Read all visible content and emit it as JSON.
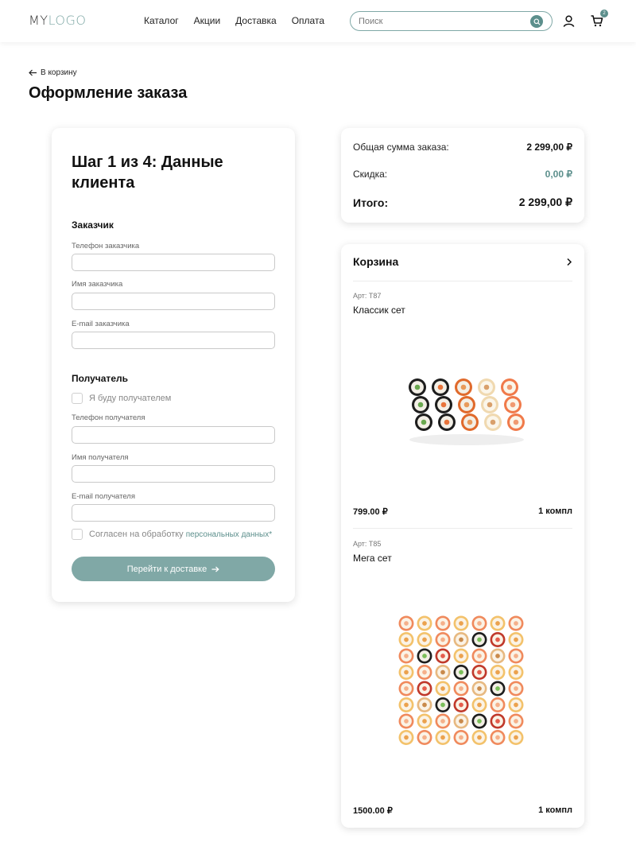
{
  "header": {
    "logo_my": "MY",
    "logo_rest": "LOGO",
    "nav": [
      "Каталог",
      "Акции",
      "Доставка",
      "Оплата"
    ],
    "search_placeholder": "Поиск",
    "cart_count": "2",
    "accent": "#5c8f8c"
  },
  "page": {
    "back_label": "В корзину",
    "title": "Оформление заказа"
  },
  "form": {
    "step_title": "Шаг 1 из 4: Данные клиента",
    "customer_section": "Заказчик",
    "customer_phone_label": "Телефон заказчика",
    "customer_name_label": "Имя заказчика",
    "customer_email_label": "E-mail заказчика",
    "recipient_section": "Получатель",
    "self_recipient_label": "Я буду получателем",
    "recipient_phone_label": "Телефон получателя",
    "recipient_name_label": "Имя получателя",
    "recipient_email_label": "E-mail получателя",
    "consent_text": "Согласен на обработку",
    "consent_link": "персональных данных",
    "consent_mark": "*",
    "submit_label": "Перейти к доставке"
  },
  "summary": {
    "total_label": "Общая сумма заказа:",
    "total_value": "2 299,00 ₽",
    "discount_label": "Скидка:",
    "discount_value": "0,00 ₽",
    "grand_label": "Итого:",
    "grand_value": "2 299,00 ₽"
  },
  "cart": {
    "title": "Корзина",
    "items": [
      {
        "art": "Арт: Т87",
        "name": "Классик сет",
        "price": "799.00 ₽",
        "qty": "1 компл",
        "image": "sushi-set-image"
      },
      {
        "art": "Арт: Т85",
        "name": "Мега сет",
        "price": "1500.00 ₽",
        "qty": "1 компл",
        "image": "sushi-set-image"
      }
    ]
  }
}
